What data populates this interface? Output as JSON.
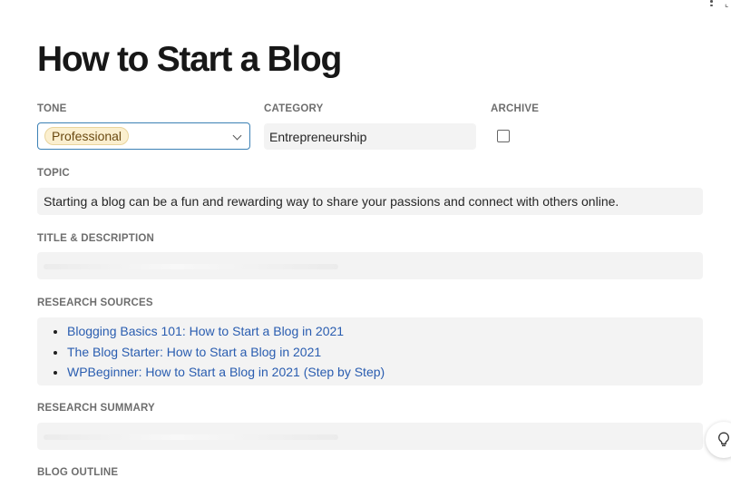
{
  "page": {
    "title": "How to Start a Blog"
  },
  "fields": {
    "tone": {
      "label": "TONE",
      "value": "Professional"
    },
    "category": {
      "label": "CATEGORY",
      "value": "Entrepreneurship"
    },
    "archive": {
      "label": "ARCHIVE",
      "checked": false
    },
    "topic": {
      "label": "TOPIC",
      "value": "Starting a blog can be a fun and rewarding way to share your passions and connect with others online."
    },
    "title_description": {
      "label": "TITLE & DESCRIPTION",
      "value": ""
    },
    "research_sources": {
      "label": "RESEARCH SOURCES",
      "items": [
        "Blogging Basics 101: How to Start a Blog in 2021",
        "The Blog Starter: How to Start a Blog in 2021",
        "WPBeginner: How to Start a Blog in 2021 (Step by Step)"
      ]
    },
    "research_summary": {
      "label": "RESEARCH SUMMARY",
      "value": ""
    },
    "blog_outline": {
      "label": "BLOG OUTLINE"
    }
  },
  "icons": {
    "top_menu": "more-vertical-icon",
    "tone_dropdown": "chevron-down-icon",
    "assistant": "lightbulb-icon"
  },
  "colors": {
    "tone_pill_bg": "#fbefcf",
    "link": "#2a5db0",
    "focus_border": "#3c81b5"
  }
}
